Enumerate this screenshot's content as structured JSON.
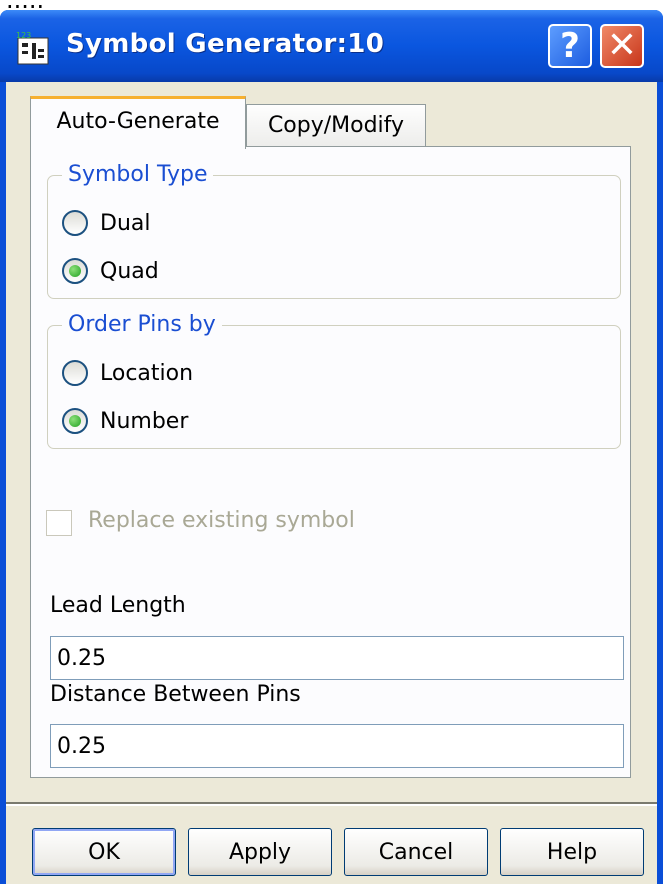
{
  "window": {
    "title": "Symbol Generator:10"
  },
  "tabs": [
    {
      "label": "Auto-Generate",
      "active": true
    },
    {
      "label": "Copy/Modify",
      "active": false
    }
  ],
  "symbol_type": {
    "label": "Symbol Type",
    "options": [
      {
        "label": "Dual",
        "selected": false
      },
      {
        "label": "Quad",
        "selected": true
      }
    ]
  },
  "order_pins": {
    "label": "Order Pins by",
    "options": [
      {
        "label": "Location",
        "selected": false
      },
      {
        "label": "Number",
        "selected": true
      }
    ]
  },
  "replace_existing": {
    "label": "Replace existing symbol",
    "checked": false,
    "enabled": false
  },
  "lead_length": {
    "label": "Lead Length",
    "value": "0.25"
  },
  "distance_between_pins": {
    "label": "Distance Between Pins",
    "value": "0.25"
  },
  "buttons": {
    "ok": "OK",
    "apply": "Apply",
    "cancel": "Cancel",
    "help": "Help"
  },
  "colors": {
    "titlebar": "#0a56df",
    "dialog_bg": "#ece9d8",
    "group_label": "#1a4ed2",
    "radio_selected": "#21a121"
  },
  "icons": {
    "app": "symbol-generator-icon",
    "help": "question-mark-icon",
    "close": "close-x-icon"
  }
}
